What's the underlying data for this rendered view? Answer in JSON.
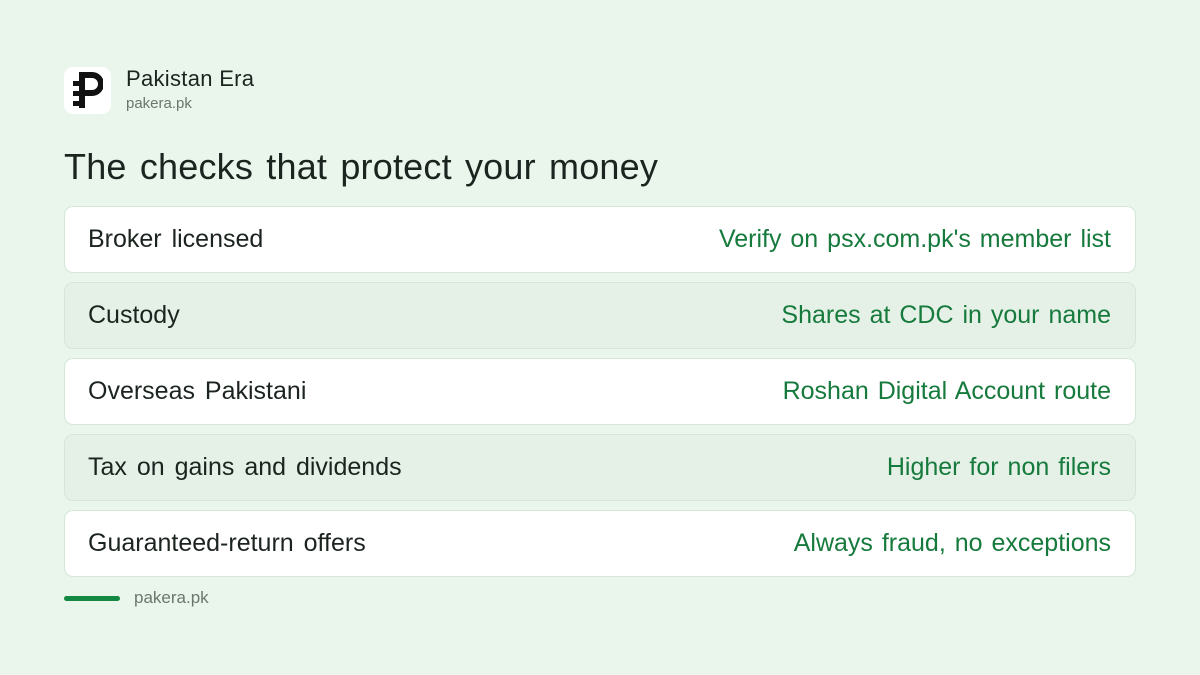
{
  "brand": {
    "name": "Pakistan Era",
    "url": "pakera.pk",
    "logo_icon": "pakistan-era-logo-icon"
  },
  "title": "The checks that protect your money",
  "rows": [
    {
      "label": "Broker licensed",
      "value": "Verify on psx.com.pk's member list"
    },
    {
      "label": "Custody",
      "value": "Shares at CDC in your name"
    },
    {
      "label": "Overseas Pakistani",
      "value": "Roshan Digital Account route"
    },
    {
      "label": "Tax on gains and dividends",
      "value": "Higher for non filers"
    },
    {
      "label": "Guaranteed-return offers",
      "value": "Always fraud, no exceptions"
    }
  ],
  "footer": {
    "url": "pakera.pk"
  },
  "colors": {
    "background": "#eaf5ec",
    "accent": "#167a3c",
    "footer_bar": "#138841",
    "text": "#1b241e",
    "muted": "#6b766e"
  }
}
